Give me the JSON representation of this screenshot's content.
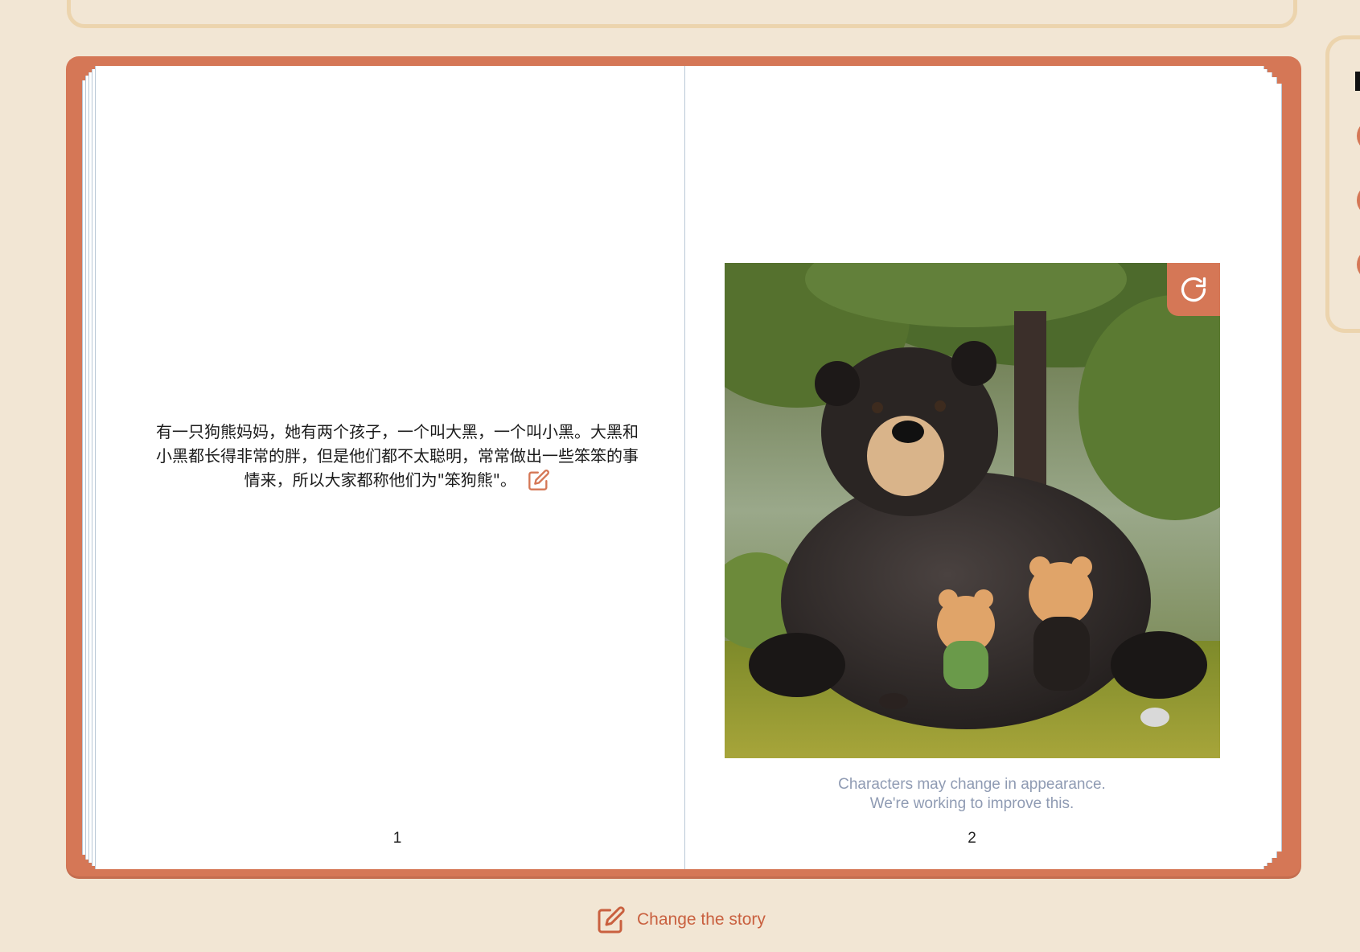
{
  "book": {
    "left_page": {
      "text": "有一只狗熊妈妈，她有两个孩子，一个叫大黑，一个叫小黑。大黑和小黑都长得非常的胖，但是他们都不太聪明，常常做出一些笨笨的事情来，所以大家都称他们为\"笨狗熊\"。",
      "page_number": "1",
      "edit_icon": "edit-pencil-square-icon"
    },
    "right_page": {
      "illustration": "3D cartoon black bear with two small tan bear cubs in a forest",
      "regenerate_icon": "refresh-icon",
      "caption_line1": "Characters may change in appearance.",
      "caption_line2": "We're working to improve this.",
      "page_number": "2"
    }
  },
  "footer": {
    "change_story_label": "Change the story",
    "change_story_icon": "edit-pencil-square-icon"
  },
  "colors": {
    "background": "#f2e6d4",
    "book_cover": "#d57756",
    "accent_text": "#c9603f",
    "caption": "#8f9bb3",
    "panel_border": "#ecd4ad"
  }
}
